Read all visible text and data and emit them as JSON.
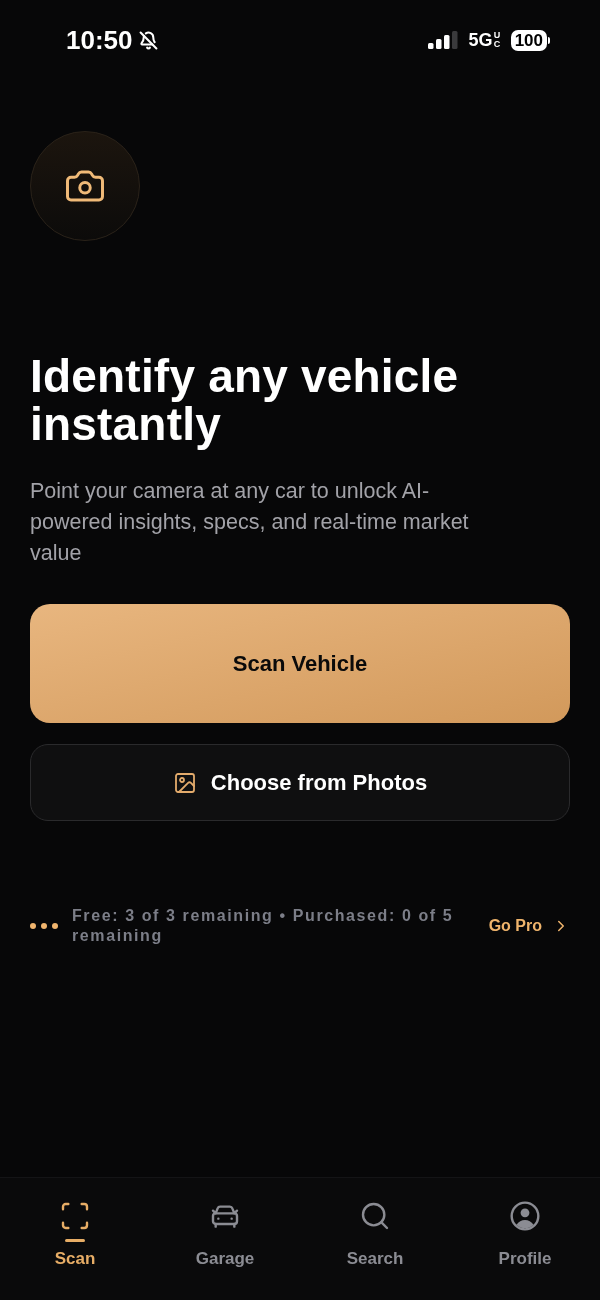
{
  "status_bar": {
    "time": "10:50",
    "silent": true,
    "network": "5G",
    "network_suffix": "UC",
    "battery": "100"
  },
  "hero": {
    "title": "Identify any vehicle instantly",
    "subtitle": "Point your camera at any car to unlock AI-powered insights, specs, and real-time market value"
  },
  "actions": [
    {
      "kind": "primary",
      "label": "Scan Vehicle"
    },
    {
      "kind": "secondary",
      "label": "Choose from Photos"
    }
  ],
  "usage": {
    "text": "Free: 3 of 3 remaining • Purchased: 0 of 5 remaining",
    "link": "Go Pro"
  },
  "tabs": [
    {
      "label": "Scan",
      "selected": true
    },
    {
      "label": "Garage",
      "selected": false
    },
    {
      "label": "Search",
      "selected": false
    },
    {
      "label": "Profile",
      "selected": false
    }
  ]
}
